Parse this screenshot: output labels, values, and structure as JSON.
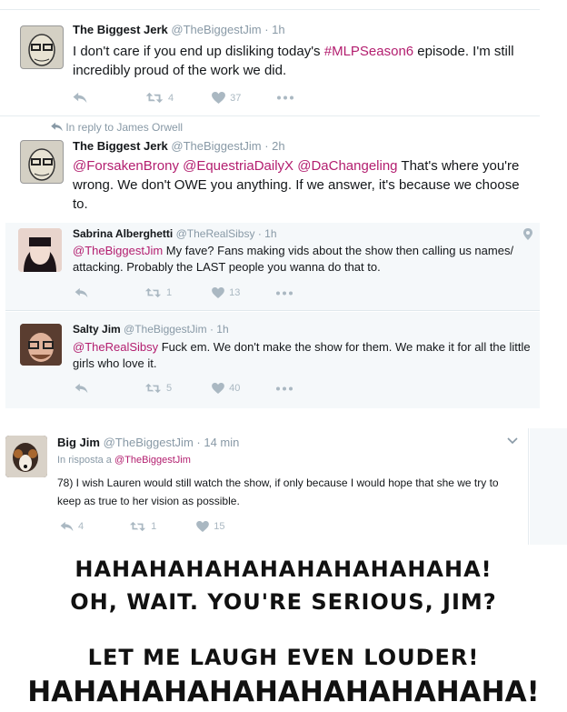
{
  "tweets": [
    {
      "name": "The Biggest Jerk",
      "handle": "@TheBiggestJim",
      "time": "1h",
      "text_pre": "I don't care if you end up disliking today's ",
      "text_hashtag": "#MLPSeason6",
      "text_post": " episode. I'm still incredibly proud of the work we did.",
      "retweets": "4",
      "likes": "37"
    },
    {
      "reply_context": "In reply to James Orwell",
      "name": "The Biggest Jerk",
      "handle": "@TheBiggestJim",
      "time": "2h",
      "mentions": "@ForsakenBrony @EquestriaDailyX @DaChangeling",
      "text": " That's where you're wrong. We don't OWE you anything. If we answer, it's because we choose to."
    },
    {
      "name": "Sabrina Alberghetti",
      "handle": "@TheRealSibsy",
      "time": "1h",
      "mention": "@TheBiggestJim",
      "text": " My fave? Fans making vids about the show then calling us names/ attacking. Probably the LAST people you wanna do that to.",
      "retweets": "1",
      "likes": "13"
    },
    {
      "name": "Salty Jim",
      "handle": "@TheBiggestJim",
      "time": "1h",
      "mention": "@TheRealSibsy",
      "text": " Fuck em. We don't make the show for them. We make it for all the little girls who love it.",
      "retweets": "5",
      "likes": "40"
    },
    {
      "name": "Big Jim",
      "handle": "@TheBiggestJim",
      "time": "14 min",
      "reply_prefix": "In risposta a ",
      "reply_to": "@TheBiggestJim",
      "text": "78) I wish Lauren would still watch the show, if only because I would hope that she we try to keep as true to her vision as possible.",
      "replies": "4",
      "retweets": "1",
      "likes": "15"
    }
  ],
  "caption": {
    "line1": "HAHAHAHAHAHAHAHAHAHAHA!",
    "line2": "OH, WAIT. YOU'RE SERIOUS, JIM?",
    "line3": "LET ME LAUGH EVEN LOUDER!",
    "line4": "HAHAHAHAHAHAHAHAHAHAHA!"
  },
  "colors": {
    "accent": "#b31e6f",
    "muted": "#8899a6",
    "icon": "#aab8c2"
  },
  "icons": [
    "reply-icon",
    "retweet-icon",
    "like-icon",
    "more-icon",
    "location-icon",
    "chevron-down-icon"
  ]
}
